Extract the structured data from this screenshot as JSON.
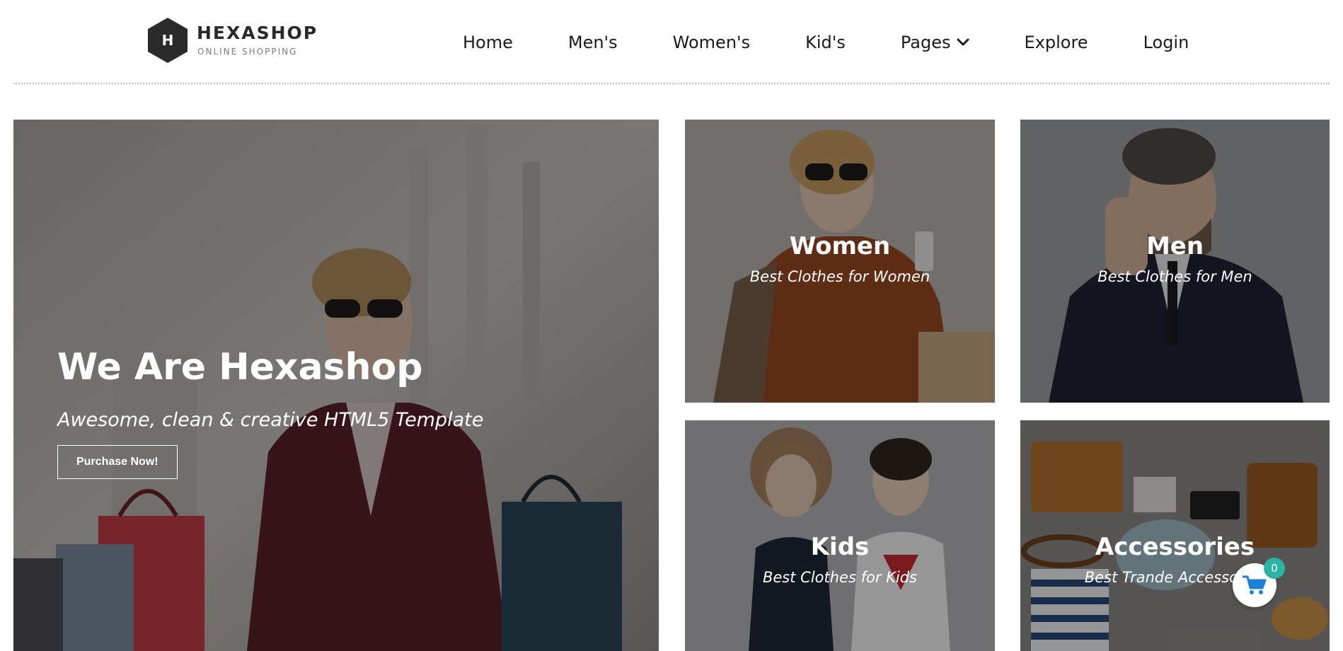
{
  "brand": {
    "logo_letter": "H",
    "name": "HEXASHOP",
    "tagline": "ONLINE SHOPPING"
  },
  "nav": {
    "items": [
      "Home",
      "Men's",
      "Women's",
      "Kid's",
      "Pages",
      "Explore",
      "Login"
    ]
  },
  "hero": {
    "title": "We Are Hexashop",
    "subtitle": "Awesome, clean & creative HTML5 Template",
    "button_label": "Purchase Now!"
  },
  "categories": [
    {
      "title": "Women",
      "subtitle": "Best Clothes for Women"
    },
    {
      "title": "Men",
      "subtitle": "Best Clothes for Men"
    },
    {
      "title": "Kids",
      "subtitle": "Best Clothes for Kids"
    },
    {
      "title": "Accessories",
      "subtitle": "Best Trande Accessories"
    }
  ],
  "cart": {
    "count": "0"
  },
  "icons": {
    "logo": "hexagon-logo-icon",
    "pages_dropdown": "chevron-down-icon",
    "cart": "shopping-cart-icon"
  },
  "colors": {
    "text_dark": "#1a1a1a",
    "accent_badge": "#2bb3a3",
    "cart_blue": "#1e7fd6",
    "white": "#ffffff"
  }
}
